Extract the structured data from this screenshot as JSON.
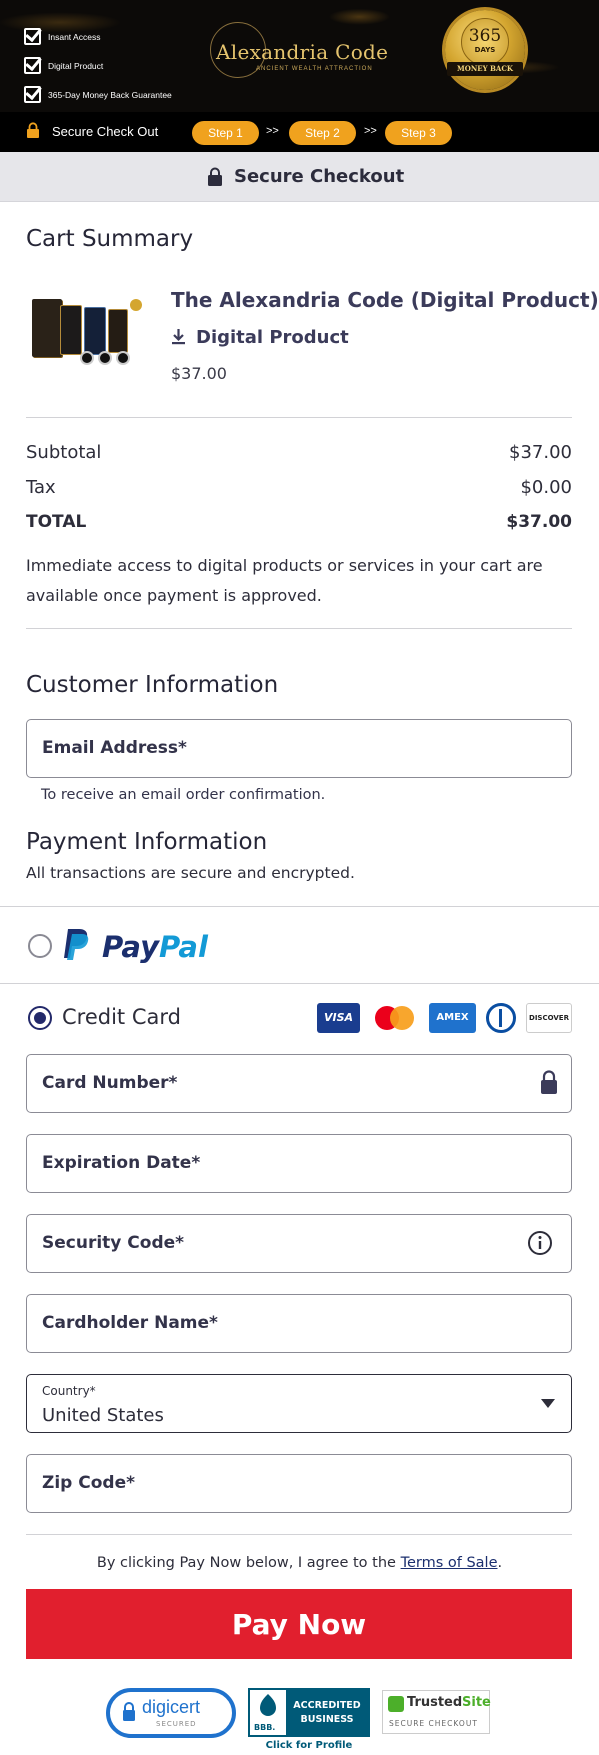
{
  "banner": {
    "checklist": [
      "Insant Access",
      "Digital Product",
      "365-Day Money Back Guarantee"
    ],
    "logo_title": "Alexandria Code",
    "logo_subtitle": "ANCIENT WEALTH ATTRACTION",
    "badge_number": "365",
    "badge_days": "DAYS",
    "badge_ribbon": "MONEY BACK"
  },
  "stepbar": {
    "secure_label": "Secure Check Out",
    "steps": [
      "Step 1",
      "Step 2",
      "Step 3"
    ],
    "arrow": ">>"
  },
  "strip": {
    "title": "Secure Checkout"
  },
  "cart": {
    "heading": "Cart Summary",
    "product_name": "The Alexandria Code (Digital Product)",
    "product_type": "Digital Product",
    "product_price": "$37.00",
    "subtotal_label": "Subtotal",
    "subtotal_value": "$37.00",
    "tax_label": "Tax",
    "tax_value": "$0.00",
    "total_label": "TOTAL",
    "total_value": "$37.00",
    "access_note": "Immediate access to digital products or services in your cart are available once payment is approved."
  },
  "customer": {
    "heading": "Customer Information",
    "email_label": "Email Address*",
    "email_hint": "To receive an email order confirmation."
  },
  "payment": {
    "heading": "Payment Information",
    "subheading": "All transactions are secure and encrypted.",
    "paypal_label_1": "Pay",
    "paypal_label_2": "Pal",
    "credit_label": "Credit Card",
    "card_brands": [
      "VISA",
      "mastercard",
      "AMEX",
      "Diners",
      "DISCOVER"
    ],
    "card_number_label": "Card Number*",
    "expiration_label": "Expiration Date*",
    "security_label": "Security Code*",
    "cardholder_label": "Cardholder Name*",
    "country_label": "Country*",
    "country_value": "United States",
    "zip_label": "Zip Code*"
  },
  "footer": {
    "terms_prefix": "By clicking Pay Now below, I agree to the ",
    "terms_link": "Terms of Sale",
    "terms_suffix": ".",
    "pay_button": "Pay Now",
    "digicert_label": "digicert",
    "digicert_sub": "SECURED",
    "bbb_line1": "ACCREDITED",
    "bbb_line2": "BUSINESS",
    "bbb_mark": "BBB.",
    "bbb_caption": "Click for Profile",
    "trusted_name_1": "Trusted",
    "trusted_name_2": "Site",
    "trusted_sub": "SECURE CHECKOUT"
  },
  "colors": {
    "pay_button": "#e11f2e",
    "step_pill": "#f0a21e",
    "radio_selected": "#23296a",
    "paypal_dark": "#1b2f6e",
    "paypal_light": "#139ad6"
  }
}
